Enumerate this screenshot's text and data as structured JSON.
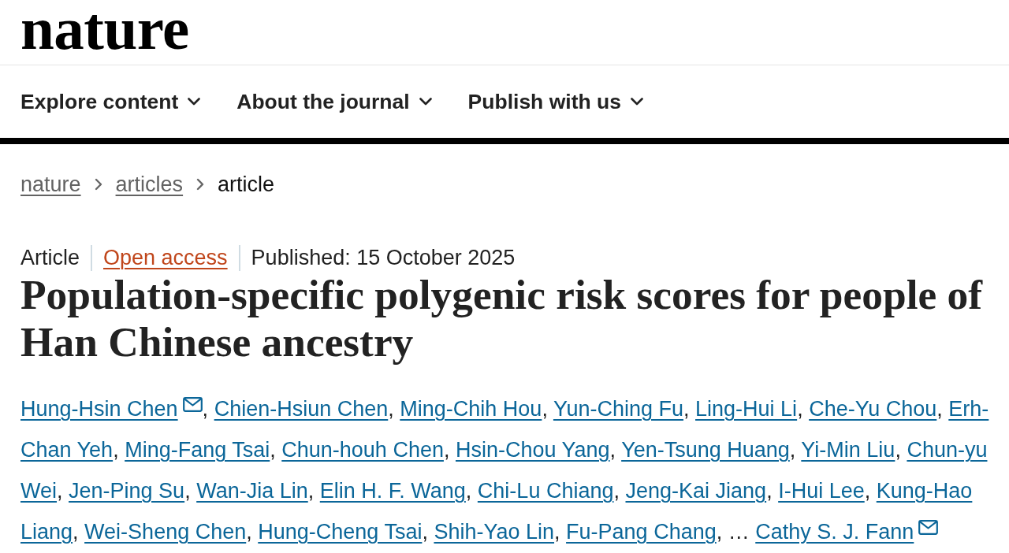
{
  "header": {
    "logo": "nature"
  },
  "nav": [
    {
      "label": "Explore content"
    },
    {
      "label": "About the journal"
    },
    {
      "label": "Publish with us"
    }
  ],
  "breadcrumbs": [
    {
      "label": "nature",
      "current": false
    },
    {
      "label": "articles",
      "current": false
    },
    {
      "label": "article",
      "current": true
    }
  ],
  "article": {
    "type": "Article",
    "access": "Open access",
    "published": "Published: 15 October 2025",
    "title": "Population-specific polygenic risk scores for people of Han Chinese ancestry",
    "authors": [
      {
        "kind": "author",
        "name": "Hung-Hsin Chen",
        "email": true,
        "separator": ","
      },
      {
        "kind": "author",
        "name": "Chien-Hsiun Chen",
        "email": false,
        "separator": ","
      },
      {
        "kind": "author",
        "name": "Ming-Chih Hou",
        "email": false,
        "separator": ","
      },
      {
        "kind": "author",
        "name": "Yun-Ching Fu",
        "email": false,
        "separator": ","
      },
      {
        "kind": "author",
        "name": "Ling-Hui Li",
        "email": false,
        "separator": ","
      },
      {
        "kind": "author",
        "name": "Che-Yu Chou",
        "email": false,
        "separator": ","
      },
      {
        "kind": "author",
        "name": "Erh-Chan Yeh",
        "email": false,
        "separator": ","
      },
      {
        "kind": "author",
        "name": "Ming-Fang Tsai",
        "email": false,
        "separator": ","
      },
      {
        "kind": "author",
        "name": "Chun-houh Chen",
        "email": false,
        "separator": ","
      },
      {
        "kind": "author",
        "name": "Hsin-Chou Yang",
        "email": false,
        "separator": ","
      },
      {
        "kind": "author",
        "name": "Yen-Tsung Huang",
        "email": false,
        "separator": ","
      },
      {
        "kind": "author",
        "name": "Yi-Min Liu",
        "email": false,
        "separator": ","
      },
      {
        "kind": "author",
        "name": "Chun-yu Wei",
        "email": false,
        "separator": ","
      },
      {
        "kind": "author",
        "name": "Jen-Ping Su",
        "email": false,
        "separator": ","
      },
      {
        "kind": "author",
        "name": "Wan-Jia Lin",
        "email": false,
        "separator": ","
      },
      {
        "kind": "author",
        "name": "Elin H. F. Wang",
        "email": false,
        "separator": ","
      },
      {
        "kind": "author",
        "name": "Chi-Lu Chiang",
        "email": false,
        "separator": ","
      },
      {
        "kind": "author",
        "name": "Jeng-Kai Jiang",
        "email": false,
        "separator": ","
      },
      {
        "kind": "author",
        "name": "I-Hui Lee",
        "email": false,
        "separator": ","
      },
      {
        "kind": "author",
        "name": "Kung-Hao Liang",
        "email": false,
        "separator": ","
      },
      {
        "kind": "author",
        "name": "Wei-Sheng Chen",
        "email": false,
        "separator": ","
      },
      {
        "kind": "author",
        "name": "Hung-Cheng Tsai",
        "email": false,
        "separator": ","
      },
      {
        "kind": "author",
        "name": "Shih-Yao Lin",
        "email": false,
        "separator": ","
      },
      {
        "kind": "author",
        "name": "Fu-Pang Chang",
        "email": false,
        "separator": ","
      },
      {
        "kind": "ellipsis",
        "text": "…"
      },
      {
        "kind": "author",
        "name": "Cathy S. J. Fann",
        "email": true
      }
    ]
  }
}
